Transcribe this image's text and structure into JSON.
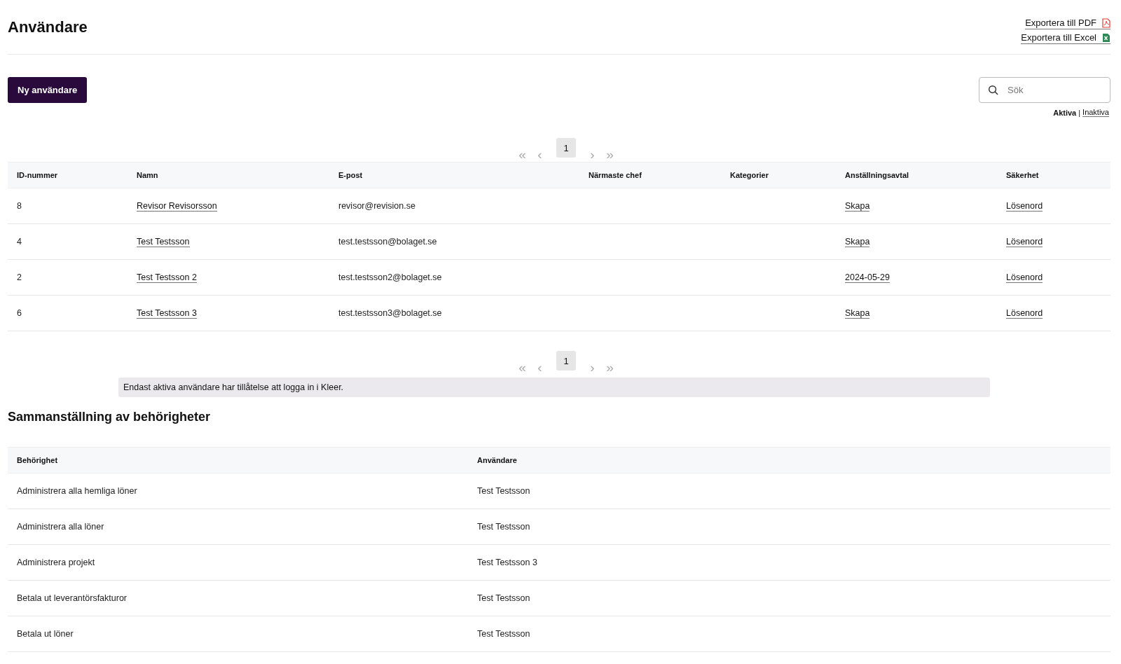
{
  "page": {
    "title": "Användare"
  },
  "exports": [
    {
      "label": "Exportera till PDF",
      "kind": "pdf"
    },
    {
      "label": "Exportera till Excel",
      "kind": "excel"
    }
  ],
  "new_button": {
    "label": "Ny användare"
  },
  "search": {
    "placeholder": "Sök"
  },
  "filters": [
    {
      "label": "Aktiva",
      "selected": true
    },
    {
      "label": "Inaktiva",
      "selected": false
    }
  ],
  "filter_separator": "|",
  "pager_top": {
    "first": "«",
    "prev": "‹",
    "pages": [
      {
        "label": "1",
        "selected": true
      }
    ],
    "next": "›",
    "last": "»"
  },
  "users_table": {
    "columns": [
      "ID-nummer",
      "Namn",
      "E-post",
      "Närmaste chef",
      "Kategorier",
      "Anställningsavtal",
      "Säkerhet"
    ],
    "rows": [
      {
        "id_number": "8",
        "name": "Revisor Revisorsson",
        "email": "revisor@revision.se",
        "contract": "Skapa",
        "security": "Lösenord"
      },
      {
        "id_number": "4",
        "name": "Test Testsson",
        "email": "test.testsson@bolaget.se",
        "contract": "Skapa",
        "security": "Lösenord"
      },
      {
        "id_number": "2",
        "name": "Test Testsson 2",
        "email": "test.testsson2@bolaget.se",
        "contract": "2024-05-29",
        "security": "Lösenord"
      },
      {
        "id_number": "6",
        "name": "Test Testsson 3",
        "email": "test.testsson3@bolaget.se",
        "contract": "Skapa",
        "security": "Lösenord"
      }
    ]
  },
  "pager_bottom": {
    "first": "«",
    "prev": "‹",
    "pages": [
      {
        "label": "1",
        "selected": true
      }
    ],
    "next": "›",
    "last": "»"
  },
  "note": "Endast aktiva användare har tillåtelse att logga in i Kleer.",
  "permissions": {
    "title": "Sammanställning av behörigheter",
    "columns": [
      "Behörighet",
      "Användare"
    ],
    "rows": [
      {
        "permission": "Administrera alla hemliga löner",
        "user": "Test Testsson"
      },
      {
        "permission": "Administrera alla löner",
        "user": "Test Testsson"
      },
      {
        "permission": "Administrera projekt",
        "user": "Test Testsson 3"
      },
      {
        "permission": "Betala ut leverantörsfakturor",
        "user": "Test Testsson"
      },
      {
        "permission": "Betala ut löner",
        "user": "Test Testsson"
      }
    ]
  }
}
